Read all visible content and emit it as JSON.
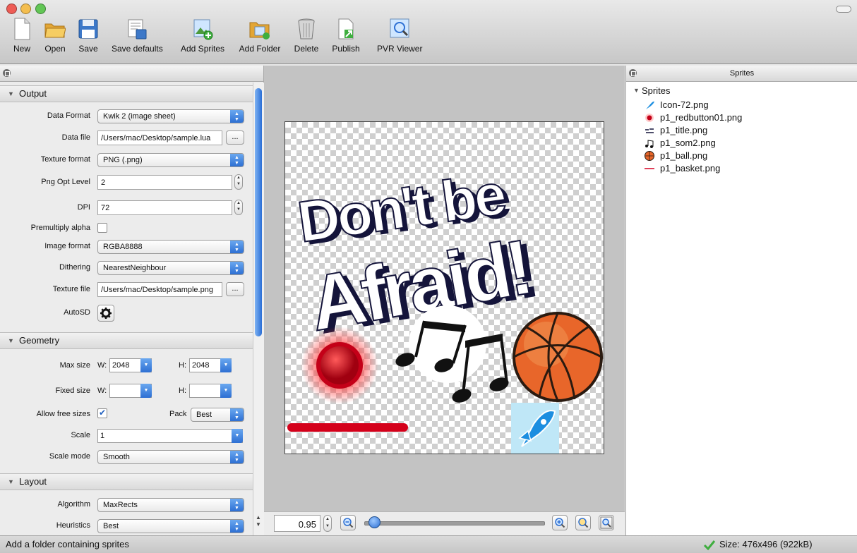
{
  "toolbar": {
    "buttons": [
      {
        "label": "New",
        "icon": "new-document-icon"
      },
      {
        "label": "Open",
        "icon": "folder-open-icon"
      },
      {
        "label": "Save",
        "icon": "floppy-disk-icon"
      },
      {
        "label": "Save defaults",
        "icon": "save-defaults-icon"
      },
      {
        "label": "Add Sprites",
        "icon": "add-sprites-icon"
      },
      {
        "label": "Add Folder",
        "icon": "add-folder-icon"
      },
      {
        "label": "Delete",
        "icon": "trash-can-icon"
      },
      {
        "label": "Publish",
        "icon": "publish-icon"
      },
      {
        "label": "PVR Viewer",
        "icon": "pvr-viewer-icon"
      }
    ]
  },
  "settings": {
    "output": {
      "title": "Output",
      "data_format_label": "Data Format",
      "data_format_value": "Kwik 2 (image sheet)",
      "data_file_label": "Data file",
      "data_file_value": "/Users/mac/Desktop/sample.lua",
      "browse_label": "...",
      "texture_format_label": "Texture format",
      "texture_format_value": "PNG (.png)",
      "png_opt_label": "Png Opt Level",
      "png_opt_value": "2",
      "dpi_label": "DPI",
      "dpi_value": "72",
      "premultiply_label": "Premultiply alpha",
      "premultiply_checked": false,
      "image_format_label": "Image format",
      "image_format_value": "RGBA8888",
      "dithering_label": "Dithering",
      "dithering_value": "NearestNeighbour",
      "texture_file_label": "Texture file",
      "texture_file_value": "/Users/mac/Desktop/sample.png",
      "autosd_label": "AutoSD"
    },
    "geometry": {
      "title": "Geometry",
      "max_size_label": "Max size",
      "w_label": "W:",
      "h_label": "H:",
      "max_w": "2048",
      "max_h": "2048",
      "fixed_size_label": "Fixed size",
      "fixed_w": "",
      "fixed_h": "",
      "allow_free_label": "Allow free sizes",
      "allow_free_checked": true,
      "pack_label": "Pack",
      "pack_value": "Best",
      "scale_label": "Scale",
      "scale_value": "1",
      "scale_mode_label": "Scale mode",
      "scale_mode_value": "Smooth"
    },
    "layout": {
      "title": "Layout",
      "algorithm_label": "Algorithm",
      "algorithm_value": "MaxRects",
      "heuristics_label": "Heuristics",
      "heuristics_value": "Best"
    }
  },
  "preview": {
    "art_line1": "Don't be",
    "art_line2": "Afraid!",
    "zoom_value": "0.95",
    "zoom_slider_fraction": 0.05
  },
  "sprites_panel": {
    "title": "Sprites",
    "group_label": "Sprites",
    "items": [
      {
        "name": "Icon-72.png",
        "icon": "rocket-icon"
      },
      {
        "name": "p1_redbutton01.png",
        "icon": "red-dot-icon"
      },
      {
        "name": "p1_title.png",
        "icon": "title-thumb-icon"
      },
      {
        "name": "p1_som2.png",
        "icon": "music-notes-icon"
      },
      {
        "name": "p1_ball.png",
        "icon": "basketball-icon"
      },
      {
        "name": "p1_basket.png",
        "icon": "red-line-icon"
      }
    ]
  },
  "status": {
    "message": "Add a folder containing sprites",
    "size_text": "Size: 476x496 (922kB)"
  },
  "colors": {
    "accent_blue": "#2d6fd3",
    "text_art": "#14143a",
    "red": "#d4001a",
    "ball_orange": "#e8662a"
  }
}
